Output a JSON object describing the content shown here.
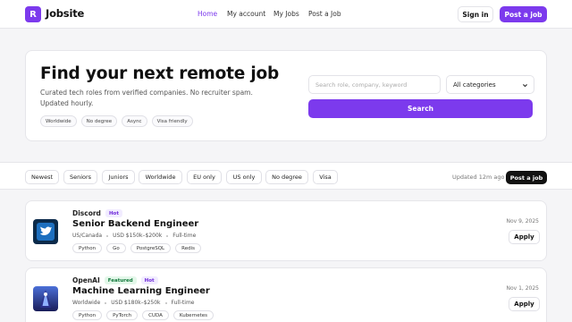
{
  "header": {
    "logo_letter": "R",
    "brand": "Jobsite",
    "nav": [
      "Home",
      "My account",
      "My Jobs",
      "Post a Job"
    ],
    "active_nav": "Home",
    "signin_label": "Sign in",
    "post_label": "Post a job",
    "accent_color": "#7c3aed"
  },
  "hero": {
    "title": "Find your next remote job",
    "subtitle": "Curated tech roles from verified companies. No recruiter spam. Updated hourly.",
    "tags": [
      "Worldwide",
      "No degree",
      "Async",
      "Visa friendly"
    ],
    "search_placeholder": "Search role, company, keyword",
    "category_selected": "All categories",
    "search_button": "Search"
  },
  "filters": {
    "chips": [
      "Newest",
      "Seniors",
      "Juniors",
      "Worldwide",
      "EU only",
      "US only",
      "No degree",
      "Visa"
    ],
    "updated": "Updated 12m ago",
    "post_button": "Post a job"
  },
  "jobs": [
    {
      "company": "Discord",
      "badges": [
        "Hot"
      ],
      "title": "Senior Backend Engineer",
      "location": "US/Canada",
      "salary": "USD $150k–$200k",
      "type": "Full-time",
      "skills": [
        "Python",
        "Go",
        "PostgreSQL",
        "Redis"
      ],
      "date": "Nov 9, 2025",
      "apply": "Apply",
      "logo_icon": "bird-icon"
    },
    {
      "company": "OpenAI",
      "badges": [
        "Featured",
        "Hot"
      ],
      "title": "Machine Learning Engineer",
      "location": "Worldwide",
      "salary": "USD $180k–$250k",
      "type": "Full-time",
      "skills": [
        "Python",
        "PyTorch",
        "CUDA",
        "Kubernetes"
      ],
      "date": "Nov 1, 2025",
      "apply": "Apply",
      "logo_icon": "figure-icon"
    }
  ]
}
